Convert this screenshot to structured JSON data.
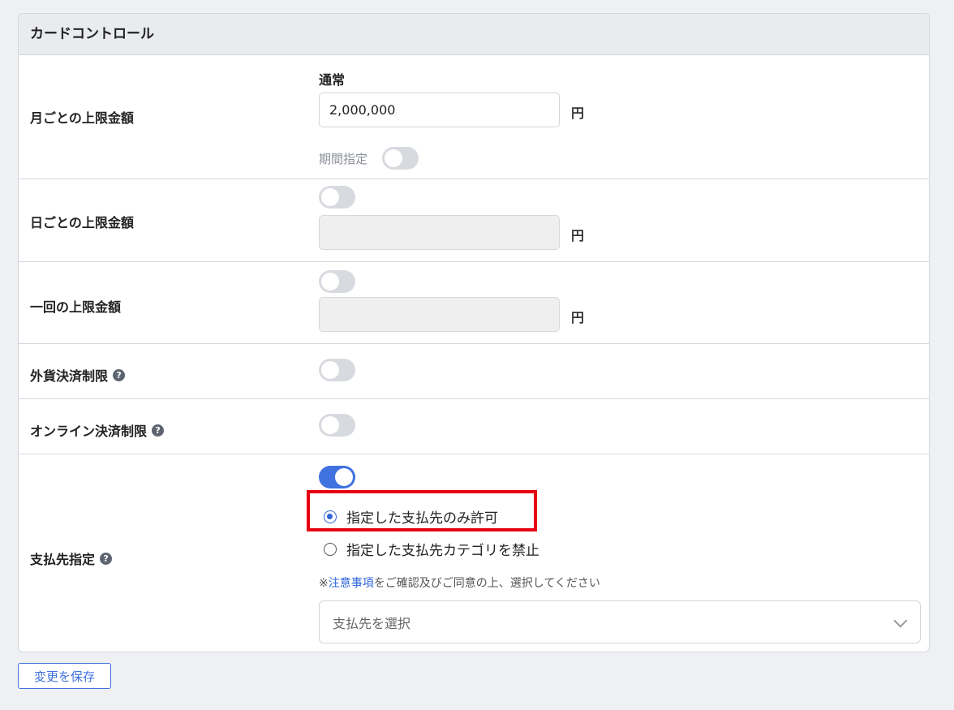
{
  "card": {
    "title": "カードコントロール"
  },
  "monthly": {
    "label": "月ごとの上限金額",
    "sublabel": "通常",
    "value": "2,000,000",
    "unit": "円",
    "period_label": "期間指定",
    "period_toggle": false
  },
  "daily": {
    "label": "日ごとの上限金額",
    "toggle": false,
    "value": "",
    "unit": "円"
  },
  "single": {
    "label": "一回の上限金額",
    "toggle": false,
    "value": "",
    "unit": "円"
  },
  "foreign": {
    "label": "外貨決済制限",
    "help": "?",
    "toggle": false
  },
  "online": {
    "label": "オンライン決済制限",
    "help": "?",
    "toggle": false
  },
  "payee": {
    "label": "支払先指定",
    "help": "?",
    "toggle": true,
    "options": [
      {
        "label": "指定した支払先のみ許可",
        "checked": true
      },
      {
        "label": "指定した支払先カテゴリを禁止",
        "checked": false
      }
    ],
    "note_prefix": "※",
    "note_link": "注意事項",
    "note_suffix": "をご確認及びご同意の上、選択してください",
    "select_placeholder": "支払先を選択"
  },
  "save_label": "変更を保存",
  "colors": {
    "accent": "#3f72df",
    "highlight": "#e60012"
  }
}
